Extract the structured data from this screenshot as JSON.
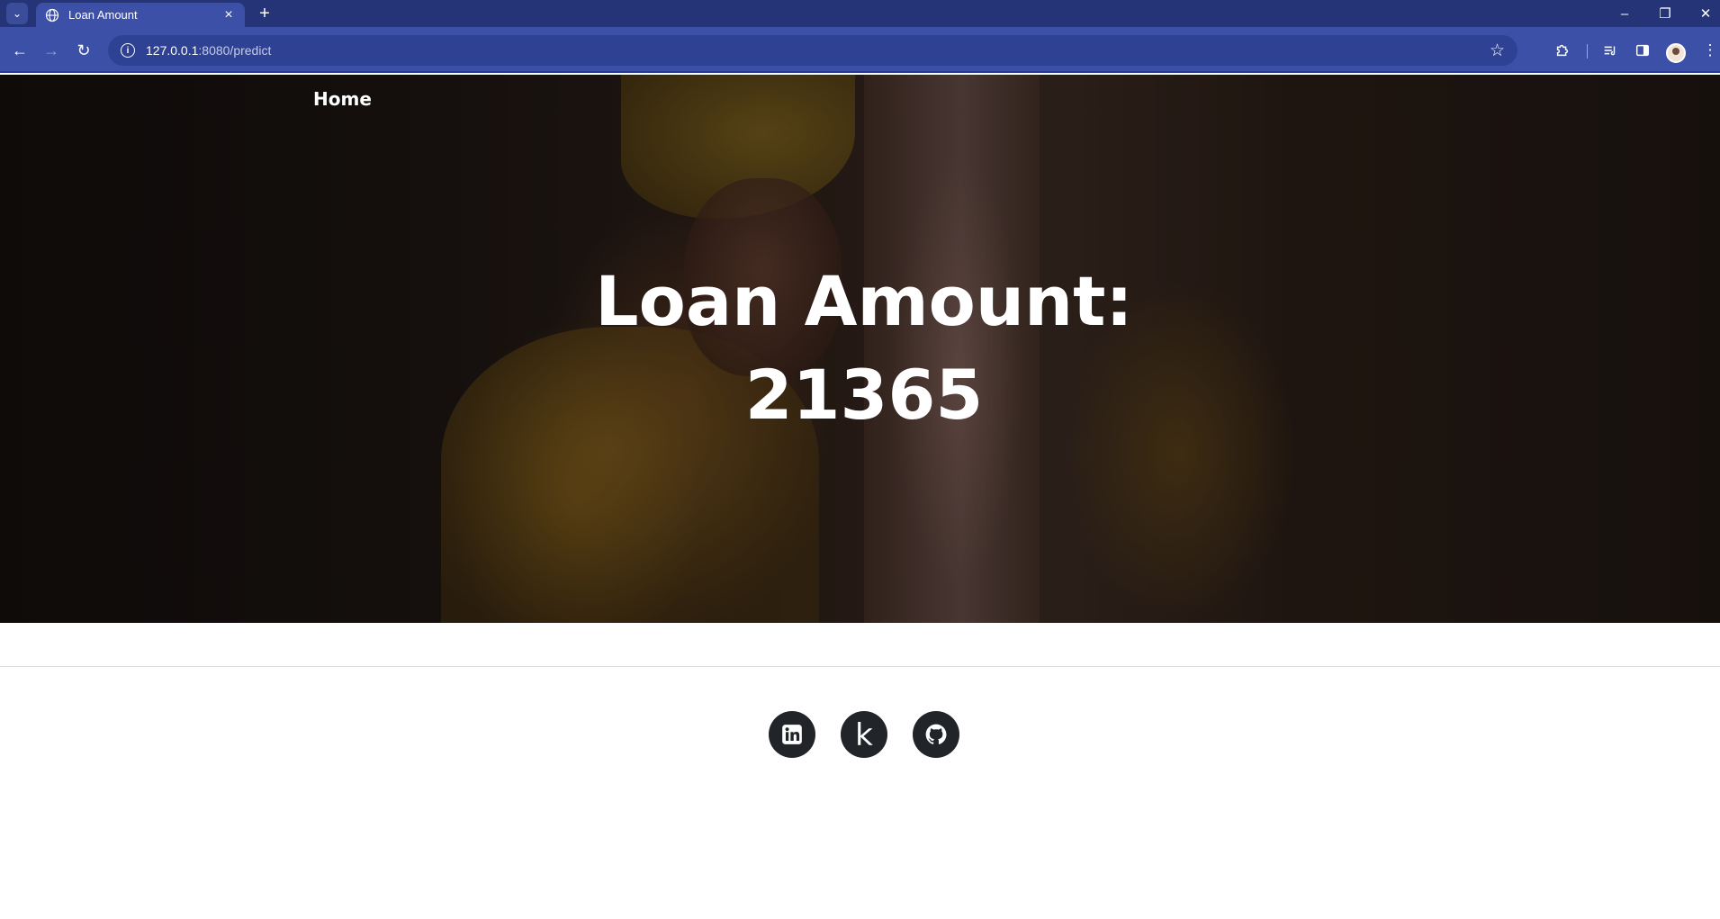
{
  "browser": {
    "tab_title": "Loan Amount",
    "url_host": "127.0.0.1",
    "url_path": ":8080/predict"
  },
  "page": {
    "nav_home": "Home",
    "headline_line1": "Loan Amount:",
    "headline_line2": "21365"
  },
  "footer": {
    "social": [
      {
        "name": "linkedin-icon"
      },
      {
        "name": "kaggle-icon",
        "glyph": "k"
      },
      {
        "name": "github-icon"
      }
    ]
  },
  "colors": {
    "chrome_tabstrip": "#253476",
    "chrome_toolbar": "#3d50a8",
    "social_bg": "#212529"
  }
}
